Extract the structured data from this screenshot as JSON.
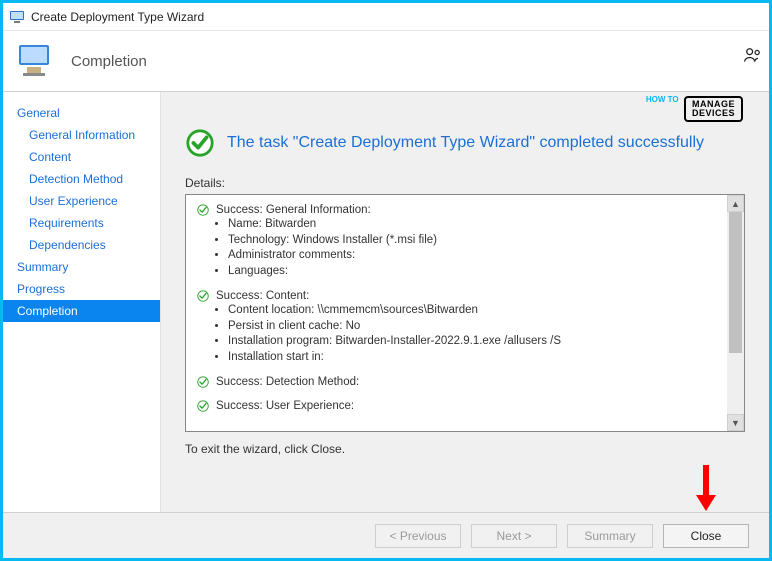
{
  "window": {
    "title": "Create Deployment Type Wizard"
  },
  "header": {
    "heading": "Completion"
  },
  "sidebar": {
    "items": [
      {
        "label": "General",
        "sub": false
      },
      {
        "label": "General Information",
        "sub": true
      },
      {
        "label": "Content",
        "sub": true
      },
      {
        "label": "Detection Method",
        "sub": true
      },
      {
        "label": "User Experience",
        "sub": true
      },
      {
        "label": "Requirements",
        "sub": true
      },
      {
        "label": "Dependencies",
        "sub": true
      },
      {
        "label": "Summary",
        "sub": false
      },
      {
        "label": "Progress",
        "sub": false
      },
      {
        "label": "Completion",
        "sub": false,
        "active": true
      }
    ]
  },
  "main": {
    "status_text": "The task \"Create Deployment Type Wizard\" completed successfully",
    "details_label": "Details:",
    "sections": [
      {
        "head": "Success: General Information:",
        "lines": [
          "Name: Bitwarden",
          "Technology: Windows Installer (*.msi file)",
          "Administrator comments:",
          "Languages:"
        ]
      },
      {
        "head": "Success: Content:",
        "lines": [
          "Content location: \\\\cmmemcm\\sources\\Bitwarden",
          "Persist in client cache: No",
          "Installation program: Bitwarden-Installer-2022.9.1.exe /allusers /S",
          "Installation start in:"
        ]
      },
      {
        "head": "Success: Detection Method:",
        "lines": []
      },
      {
        "head": "Success: User Experience:",
        "lines": []
      }
    ],
    "exit_text": "To exit the wizard, click Close."
  },
  "footer": {
    "previous": "< Previous",
    "next": "Next >",
    "summary": "Summary",
    "close": "Close"
  },
  "watermark": {
    "pre": "HOW TO",
    "line1": "MANAGE",
    "line2": "DEVICES"
  }
}
